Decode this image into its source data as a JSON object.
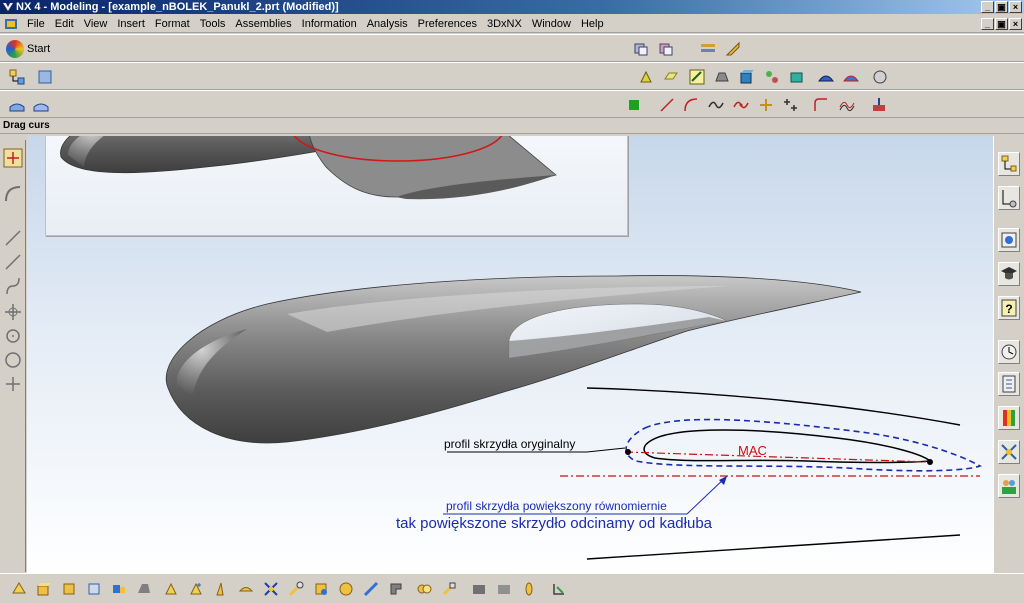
{
  "window": {
    "title": "NX 4 - Modeling - [example_nBOLEK_Panukl_2.prt (Modified)]",
    "buttons": [
      "_",
      "×"
    ]
  },
  "menubar": {
    "items": [
      "File",
      "Edit",
      "View",
      "Insert",
      "Format",
      "Tools",
      "Assemblies",
      "Information",
      "Analysis",
      "Preferences",
      "3DxNX",
      "Window",
      "Help"
    ]
  },
  "toolbar": {
    "start_label": "Start"
  },
  "statusline": {
    "text": "Drag curs"
  },
  "annotations": {
    "original_profile": "profil skrzydła oryginalny",
    "mac": "MAC",
    "enlarged_profile": "profil skrzydła powiększony równomiernie",
    "cut_note": "tak powiększone skrzydło odcinamy od kadłuba"
  },
  "colors": {
    "annotation_blue": "#1a2bb0",
    "mac_red": "#cc1010",
    "highlight_ring": "#d01818",
    "titlebar": "#0a246a"
  },
  "icons": {
    "bottom_tools": [
      "feature-icon",
      "block-icon",
      "cylinder-icon",
      "extrude-icon",
      "revolve-icon",
      "hole-icon",
      "boss-icon",
      "pad-icon",
      "pocket-icon",
      "slot-icon",
      "groove-icon",
      "blend-icon",
      "chamfer-icon",
      "shell-icon",
      "draft-icon",
      "trim-icon",
      "split-icon",
      "sew-icon",
      "pattern-icon",
      "mirror-icon",
      "offset-icon",
      "scale-icon",
      "thicken-icon",
      "body-icon",
      "face-icon"
    ],
    "right_tools": [
      "assembly-navigator-icon",
      "part-navigator-icon",
      "web-browser-icon",
      "training-icon",
      "help-icon",
      "history-icon",
      "reuse-library-icon",
      "palette-icon",
      "roles-icon",
      "system-icon"
    ]
  }
}
